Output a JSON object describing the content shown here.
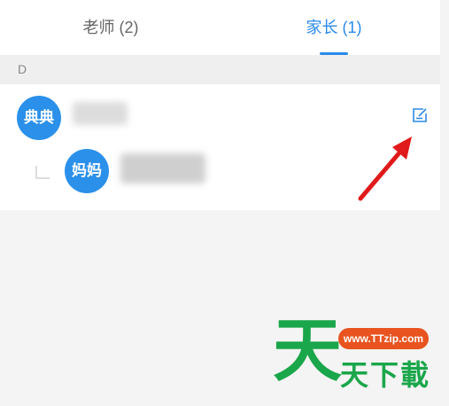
{
  "tabs": [
    {
      "label": "老师 (2)",
      "active": false
    },
    {
      "label": "家长 (1)",
      "active": true
    }
  ],
  "accent_color": "#2b8ae8",
  "section": {
    "letter": "D"
  },
  "contacts": {
    "child": {
      "avatar_text": "典典"
    },
    "parent": {
      "avatar_text": "妈妈"
    }
  },
  "icons": {
    "edit": "edit-icon",
    "annotation": "red-arrow"
  },
  "watermark": {
    "main": "天",
    "url": "www.TTzip.com",
    "sub": "天下載"
  }
}
